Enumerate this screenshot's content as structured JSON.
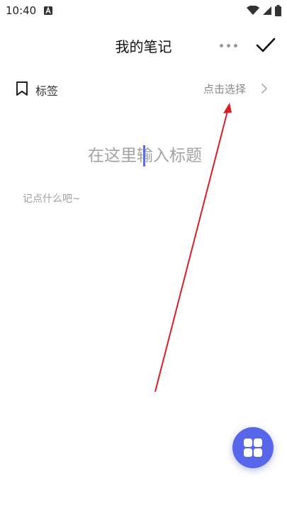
{
  "status_bar": {
    "time": "10:40"
  },
  "header": {
    "title": "我的笔记"
  },
  "tag_row": {
    "label": "标签",
    "select_text": "点击选择"
  },
  "editor": {
    "title_placeholder": "在这里输入标题",
    "body_placeholder": "记点什么吧~"
  },
  "colors": {
    "accent": "#5866ea",
    "annotation_arrow": "#d81f26",
    "placeholder": "#a3a3a3"
  },
  "icons": {
    "status_left": "notification-a-icon",
    "wifi": "wifi-icon",
    "signal": "signal-icon",
    "battery": "battery-icon",
    "more": "more-dots-icon",
    "confirm": "checkmark-icon",
    "tag": "bookmark-icon",
    "chevron": "chevron-right-icon",
    "fab": "grid-icon"
  }
}
